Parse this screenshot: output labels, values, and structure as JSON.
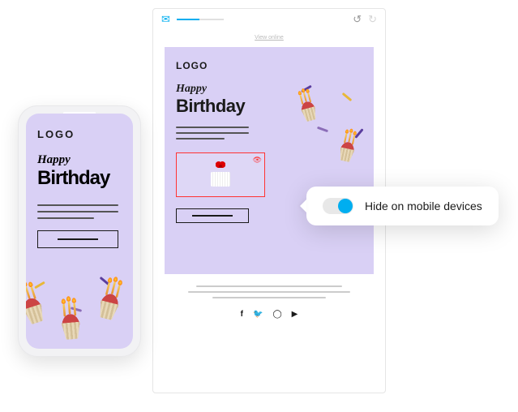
{
  "toolbar": {
    "mail_icon": "mail-icon",
    "undo_icon": "undo-icon",
    "redo_icon": "redo-icon"
  },
  "editor": {
    "view_online": "View online",
    "logo": "LOGO",
    "headline1": "Happy",
    "headline2": "Birthday",
    "selected_eye_icon": "eye-slash-icon"
  },
  "phone": {
    "logo": "LOGO",
    "headline1": "Happy",
    "headline2": "Birthday"
  },
  "tooltip": {
    "label": "Hide on mobile devices",
    "toggle_on": true
  },
  "social": {
    "facebook": "facebook-icon",
    "twitter": "twitter-icon",
    "instagram": "instagram-icon",
    "youtube": "youtube-icon"
  },
  "colors": {
    "accent": "#00aef0",
    "selection": "#ff3333",
    "canvas_bg": "#d9d0f5"
  }
}
